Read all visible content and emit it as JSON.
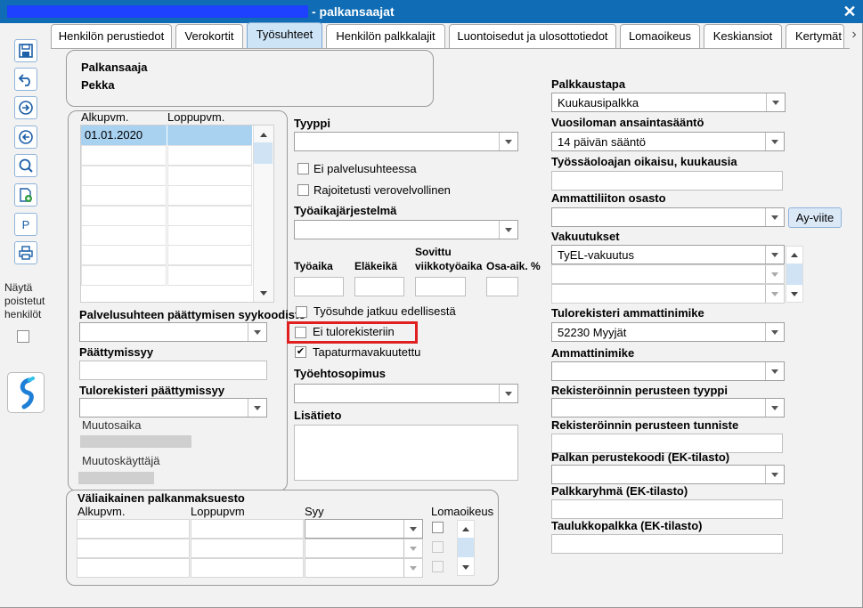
{
  "window": {
    "title": "- palkansaajat",
    "close": "✕"
  },
  "tabs": [
    {
      "label": "Henkilön perustiedot"
    },
    {
      "label": "Verokortit"
    },
    {
      "label": "Työsuhteet"
    },
    {
      "label": "Henkilön palkkalajit"
    },
    {
      "label": "Luontoisedut ja ulosottotiedot"
    },
    {
      "label": "Lomaoikeus"
    },
    {
      "label": "Keskiansiot"
    },
    {
      "label": "Kertymät"
    }
  ],
  "sidebar": {
    "show_deleted_label": "Näytä poistetut henkilöt",
    "p_label": "P"
  },
  "person": {
    "header": "Palkansaaja",
    "name": "Pekka"
  },
  "employment": {
    "col_start": "Alkupvm.",
    "col_end": "Loppupvm.",
    "rows": [
      {
        "start": "01.01.2020",
        "end": ""
      }
    ],
    "termination_reason_label": "Palvelusuhteen päättymisen syykoodisto",
    "end_reason_label": "Päättymissyy",
    "income_register_end_reason_label": "Tulorekisteri päättymissyy",
    "modified_time_label": "Muutosaika",
    "modified_by_label": "Muutoskäyttäjä"
  },
  "middle": {
    "type_label": "Tyyppi",
    "no_employment_label": "Ei palvelusuhteessa",
    "limited_tax_label": "Rajoitetusti verovelvollinen",
    "working_time_system_label": "Työaikajärjestelmä",
    "working_time_label": "Työaika",
    "retirement_age_label": "Eläkeikä",
    "agreed_weekly_label_1": "Sovittu",
    "agreed_weekly_label_2": "viikkotyöaika",
    "part_time_label": "Osa-aik. %",
    "continues_label": "Työsuhde jatkuu edellisestä",
    "no_income_register_label": "Ei tulorekisteriin",
    "accident_insured_label": "Tapaturmavakuutettu",
    "collective_agreement_label": "Työehtosopimus",
    "additional_info_label": "Lisätieto"
  },
  "right": {
    "pay_method_label": "Palkkaustapa",
    "pay_method_value": "Kuukausipalkka",
    "vacation_rule_label": "Vuosiloman ansaintasääntö",
    "vacation_rule_value": "14 päivän sääntö",
    "notice_period_label": "Työssäoloajan oikaisu, kuukausia",
    "union_label": "Ammattiliiton osasto",
    "ay_button": "Ay-viite",
    "insurances_label": "Vakuutukset",
    "insurance_value": "TyEL-vakuutus",
    "ir_occupation_label": "Tulorekisteri ammattinimike",
    "ir_occupation_value": "52230 Myyjät",
    "occupation_label": "Ammattinimike",
    "registration_basis_type_label": "Rekisteröinnin perusteen tyyppi",
    "registration_basis_id_label": "Rekisteröinnin perusteen tunniste",
    "pay_base_code_label": "Palkan perustekoodi (EK-tilasto)",
    "pay_group_label": "Palkkaryhmä (EK-tilasto)",
    "table_pay_label": "Taulukkopalkka (EK-tilasto)"
  },
  "temp_payment": {
    "title": "Väliaikainen palkanmaksuesto",
    "col_start": "Alkupvm.",
    "col_end": "Loppupvm",
    "col_reason": "Syy",
    "col_vacation": "Lomaoikeus"
  },
  "colors": {
    "titlebar": "#0f6cb5",
    "active_tab": "#cde4f7",
    "highlight": "#e02020",
    "selected_row": "#a9d1f0"
  }
}
